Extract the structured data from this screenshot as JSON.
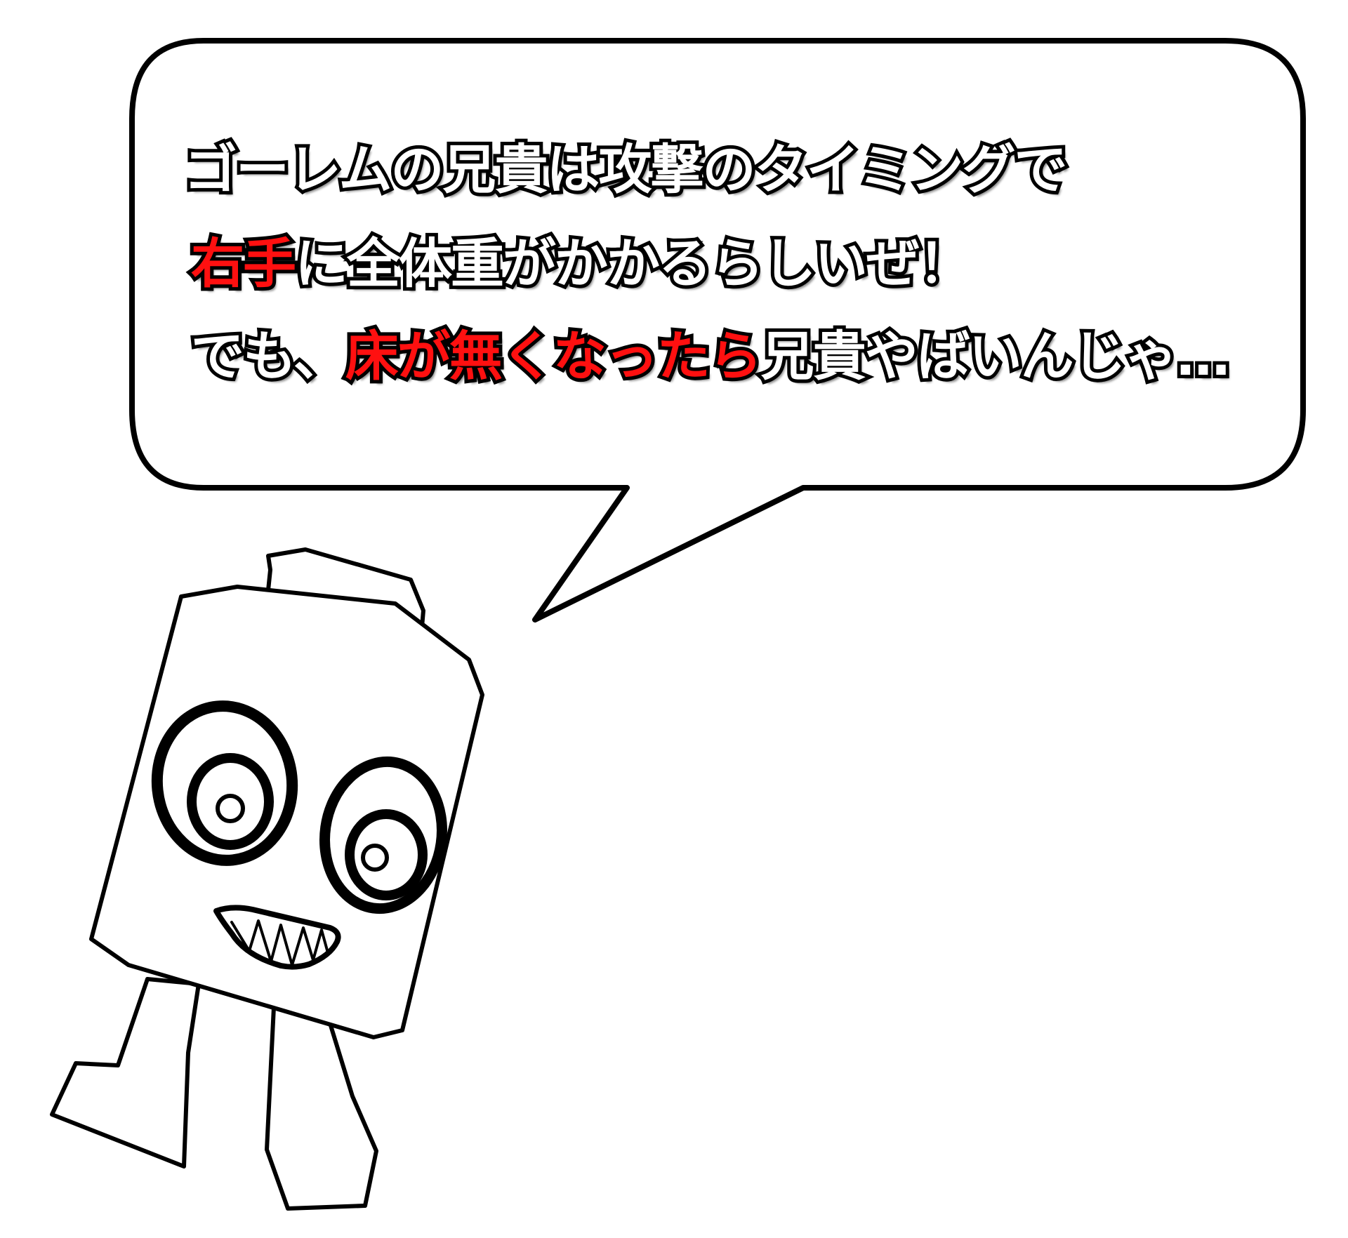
{
  "speech": {
    "line1": "ゴーレムの兄貴は攻撃のタイミングで",
    "line2_red": "右手",
    "line2_rest": "に全体重がかかるらしいぜ！",
    "line3_a": "でも、",
    "line3_red": "床が無くなったら",
    "line3_b": "兄貴やばいんじゃ…"
  },
  "colors": {
    "highlight": "#ff1010",
    "text_fill": "#ffffff",
    "outline": "#000000",
    "background": "#ffffff"
  },
  "character": {
    "icon": "robot-character-icon"
  }
}
